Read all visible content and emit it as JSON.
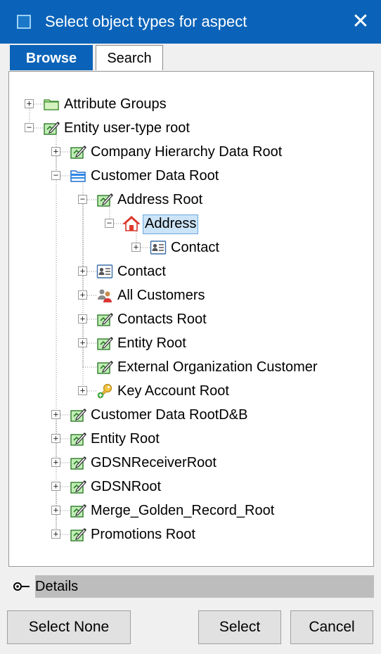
{
  "window": {
    "title": "Select object types for aspect",
    "close_glyph": "✕"
  },
  "tabs": [
    {
      "label": "Browse",
      "active": true
    },
    {
      "label": "Search",
      "active": false
    }
  ],
  "tree": {
    "nodes": [
      {
        "label": "Attribute Groups",
        "icon": "folder-icon",
        "expander": "+"
      },
      {
        "label": "Entity user-type root",
        "icon": "entity-type-icon",
        "expander": "−"
      },
      {
        "label": "Company Hierarchy Data Root",
        "icon": "entity-type-icon",
        "expander": "+"
      },
      {
        "label": "Customer Data Root",
        "icon": "folder-blue-icon",
        "expander": "−"
      },
      {
        "label": "Address Root",
        "icon": "entity-type-icon",
        "expander": "−"
      },
      {
        "label": "Address",
        "icon": "house-icon",
        "expander": "−",
        "selected": true
      },
      {
        "label": "Contact",
        "icon": "contact-card-icon",
        "expander": "+"
      },
      {
        "label": "Contact",
        "icon": "contact-card-icon",
        "expander": "+"
      },
      {
        "label": "All Customers",
        "icon": "customers-icon",
        "expander": "+"
      },
      {
        "label": "Contacts Root",
        "icon": "entity-type-icon",
        "expander": "+"
      },
      {
        "label": "Entity Root",
        "icon": "entity-type-icon",
        "expander": "+"
      },
      {
        "label": "External Organization Customer",
        "icon": "entity-type-icon",
        "expander": ""
      },
      {
        "label": "Key Account Root",
        "icon": "key-icon",
        "expander": "+"
      },
      {
        "label": "Customer Data RootD&B",
        "icon": "entity-type-icon",
        "expander": "+"
      },
      {
        "label": "Entity Root",
        "icon": "entity-type-icon",
        "expander": "+"
      },
      {
        "label": "GDSNReceiverRoot",
        "icon": "entity-type-icon",
        "expander": "+"
      },
      {
        "label": "GDSNRoot",
        "icon": "entity-type-icon",
        "expander": "+"
      },
      {
        "label": "Merge_Golden_Record_Root",
        "icon": "entity-type-icon",
        "expander": "+"
      },
      {
        "label": "Promotions Root",
        "icon": "entity-type-icon",
        "expander": "+"
      }
    ]
  },
  "details": {
    "label": "Details"
  },
  "buttons": {
    "select_none": "Select None",
    "select": "Select",
    "cancel": "Cancel"
  },
  "colors": {
    "titlebar": "#0a63b8",
    "selection": "#cce4f7",
    "details_bar": "#bdbdbd"
  }
}
